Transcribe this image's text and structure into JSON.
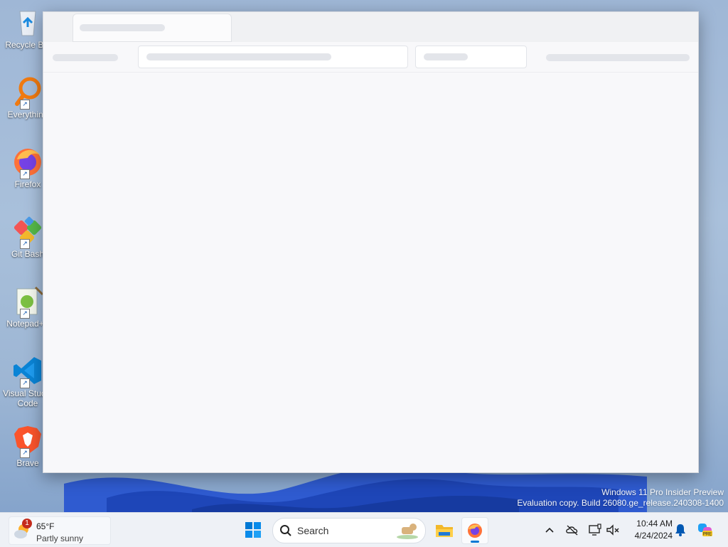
{
  "desktop": {
    "icons": [
      {
        "label": "Recycle Bin",
        "icon": "recycle-bin-icon"
      },
      {
        "label": "Everything",
        "icon": "everything-search-icon"
      },
      {
        "label": "Firefox",
        "icon": "firefox-icon"
      },
      {
        "label": "Git Bash",
        "icon": "git-bash-icon"
      },
      {
        "label": "Notepad++",
        "icon": "notepad-plus-plus-icon"
      },
      {
        "label": "Visual Studio Code",
        "icon": "vscode-icon"
      },
      {
        "label": "Brave",
        "icon": "brave-icon"
      }
    ],
    "watermark": {
      "line1": "Windows 11 Pro Insider Preview",
      "line2": "Evaluation copy. Build 26080.ge_release.240308-1400"
    }
  },
  "window": {
    "state": "loading"
  },
  "taskbar": {
    "weather": {
      "badge": "1",
      "temp": "65°F",
      "condition": "Partly sunny"
    },
    "search_label": "Search",
    "apps": [
      "start-icon",
      "file-explorer-icon",
      "firefox-icon"
    ],
    "tray_icons": [
      "chevron-up-icon",
      "onedrive-offline-icon",
      "display-icon",
      "audio-muted-icon",
      "notification-bell-icon",
      "copilot-pre-icon"
    ],
    "time": "10:44 AM",
    "date": "4/24/2024"
  },
  "colors": {
    "accent": "#0078d4",
    "firefox_orange": "#ff7139",
    "brave_orange": "#fb542b",
    "vscode_blue": "#0a84d6"
  }
}
